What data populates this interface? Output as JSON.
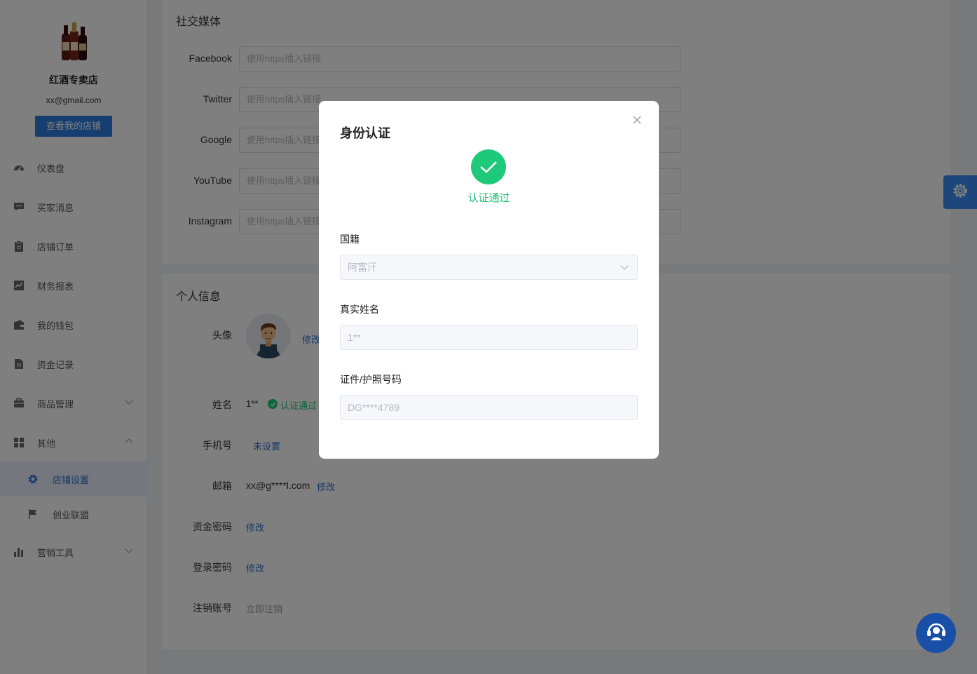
{
  "sidebar": {
    "shop_name": "红酒专卖店",
    "shop_email": "xx@gmail.com",
    "view_shop_button": "查看我的店铺",
    "items": [
      {
        "label": "仪表盘",
        "icon": "dashboard-icon"
      },
      {
        "label": "买家消息",
        "icon": "message-icon"
      },
      {
        "label": "店铺订单",
        "icon": "clipboard-icon"
      },
      {
        "label": "财务报表",
        "icon": "chart-icon"
      },
      {
        "label": "我的钱包",
        "icon": "wallet-icon"
      },
      {
        "label": "资金记录",
        "icon": "document-icon"
      },
      {
        "label": "商品管理",
        "icon": "briefcase-icon"
      },
      {
        "label": "其他",
        "icon": "grid-icon"
      },
      {
        "label": "店铺设置",
        "icon": "gear-icon"
      },
      {
        "label": "创业联盟",
        "icon": "flag-icon"
      },
      {
        "label": "营销工具",
        "icon": "bar-chart-icon"
      }
    ]
  },
  "social": {
    "title": "社交媒体",
    "placeholder": "使用https插入链接",
    "rows": [
      {
        "label": "Facebook"
      },
      {
        "label": "Twitter"
      },
      {
        "label": "Google"
      },
      {
        "label": "YouTube"
      },
      {
        "label": "Instagram"
      }
    ]
  },
  "personal": {
    "title": "个人信息",
    "avatar_label": "头像",
    "avatar_action": "修改",
    "name_label": "姓名",
    "name_value": "1**",
    "name_status": "认证通过",
    "phone_label": "手机号",
    "phone_value": "未设置",
    "email_label": "邮箱",
    "email_value": "xx@g****l.com",
    "email_action": "修改",
    "fund_pwd_label": "资金密码",
    "fund_pwd_action": "修改",
    "login_pwd_label": "登录密码",
    "login_pwd_action": "修改",
    "cancel_label": "注销账号",
    "cancel_action": "立即注销"
  },
  "modal": {
    "title": "身份认证",
    "status": "认证通过",
    "nationality_label": "国籍",
    "nationality_value": "阿富汗",
    "realname_label": "真实姓名",
    "realname_value": "1**",
    "id_label": "证件/护照号码",
    "id_value": "DG****4789"
  },
  "colors": {
    "primary": "#2f7de1",
    "success": "#1ec97a",
    "settings_tab": "#3b8ef5",
    "support": "#1a4fa8"
  }
}
